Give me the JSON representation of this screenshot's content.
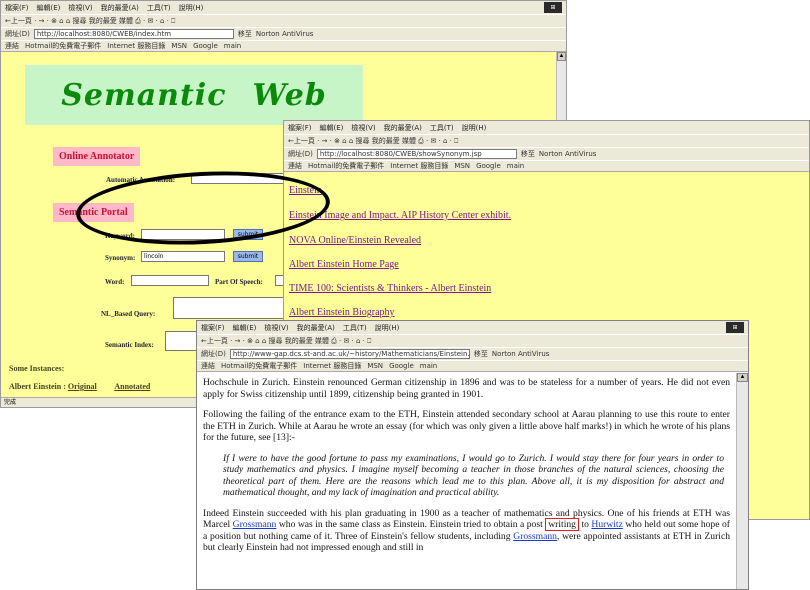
{
  "window1": {
    "menu": [
      "檔案(F)",
      "編輯(E)",
      "檢視(V)",
      "我的最愛(A)",
      "工具(T)",
      "說明(H)"
    ],
    "toolbar": "←上一頁 · → · ⊗ ⌂ ⌂ 搜尋 我的最愛 媒體 ⎙ · ✉ · ⌂ · ⎕",
    "address_label": "網址(D)",
    "address_value": "http://localhost:8080/CWEB/index.htm",
    "go_label": "移至",
    "norton_label": "Norton AntiVirus",
    "links_label": "連結",
    "links": [
      "Hotmail的免費電子郵件",
      "Internet 服務目錄",
      "MSN",
      "Google",
      "main"
    ],
    "title_word1": "Semantic",
    "title_word2": "Web",
    "online_annotator": "Online Annotator",
    "auto_annotation_label": "Automatic Annotation:",
    "semantic_portal": "Semantic Portal",
    "keyword_label": "Keyword:",
    "keyword_submit": "submit",
    "synonym_label": "Synonym:",
    "synonym_value": "lincoln",
    "synonym_submit": "submit",
    "word_label": "Word:",
    "pos_label": "Part Of Speech:",
    "nl_query_label": "NL_Based Query:",
    "semantic_index_label": "Semantic Index:",
    "some_instances": "Some Instances:",
    "instance_name": "Albert Einstein :",
    "instance_original": "Original",
    "instance_annotated": "Annotated",
    "status_text": "完成"
  },
  "window2": {
    "menu": [
      "檔案(F)",
      "編輯(E)",
      "檢視(V)",
      "我的最愛(A)",
      "工具(T)",
      "說明(H)"
    ],
    "toolbar": "←上一頁 · → · ⊗ ⌂ ⌂ 搜尋 我的最愛 媒體 ⎙ · ✉ · ⌂ · ⎕",
    "address_label": "網址(D)",
    "address_value": "http://localhost:8080/CWEB/showSynonym.jsp",
    "go_label": "移至",
    "norton_label": "Norton AntiVirus",
    "links_label": "連結",
    "links": [
      "Hotmail的免費電子郵件",
      "Internet 服務目錄",
      "MSN",
      "Google",
      "main"
    ],
    "results": [
      "Einstein",
      "Einstein Image and Impact. AIP History Center exhibit.",
      "NOVA Online/Einstein Revealed",
      "Albert Einstein Home Page",
      "TIME 100: Scientists & Thinkers - Albert Einstein",
      "Albert Einstein Biography"
    ]
  },
  "window3": {
    "menu": [
      "檔案(F)",
      "編輯(E)",
      "檢視(V)",
      "我的最愛(A)",
      "工具(T)",
      "說明(H)"
    ],
    "toolbar": "←上一頁 · → · ⊗ ⌂ ⌂ 搜尋 我的最愛 媒體 ⎙ · ✉ · ⌂ · ⎕",
    "address_label": "網址(D)",
    "address_value": "http://www-gap.dcs.st-and.ac.uk/~history/Mathematicians/Einstein.html",
    "go_label": "移至",
    "norton_label": "Norton AntiVirus",
    "links_label": "連結",
    "links": [
      "Hotmail的免費電子郵件",
      "Internet 服務目錄",
      "MSN",
      "Google",
      "main"
    ],
    "para1": "Hochschule in Zurich. Einstein renounced German citizenship in 1896 and was to be stateless for a number of years. He did not even apply for Swiss citizenship until 1899, citizenship being granted in 1901.",
    "para2": "Following the failing of the entrance exam to the ETH, Einstein attended secondary school at Aarau planning to use this route to enter the ETH in Zurich. While at Aarau he wrote an essay (for which was only given a little above half marks!) in which he wrote of his plans for the future, see [13]:-",
    "quote": "If I were to have the good fortune to pass my examinations, I would go to Zurich. I would stay there for four years in order to study mathematics and physics. I imagine myself becoming a teacher in those branches of the natural sciences, choosing the theoretical part of them. Here are the reasons which lead me to this plan. Above all, it is my disposition for abstract and mathematical thought, and my lack of imagination and practical ability.",
    "para3_a": "Indeed Einstein succeeded with his plan graduating in 1900 as a teacher of mathematics and physics. One of his friends at ETH was Marcel ",
    "para3_link1": "Grossmann",
    "para3_b": " who was in the same class as Einstein. Einstein tried to obtain a post",
    "para3_highlight": "writing",
    "para3_c": "to ",
    "para3_link2": "Hurwitz",
    "para3_d": " who held out some hope of a position but nothing came of it. Three of Einstein's fellow students, including ",
    "para3_link3": "Grossmann",
    "para3_e": ", were appointed assistants at ETH in Zurich but clearly Einstein had not impressed enough and still in"
  },
  "colors": {
    "page_yellow": "#ffff99",
    "title_green": "#0a8a0a",
    "title_bg": "#c8f5c8",
    "pink_label_bg": "#ffb8c8",
    "pink_label_text": "#c8103a",
    "visited_link": "#7a1a8a",
    "link_blue": "#1a3ad0",
    "highlight_red": "#e02020"
  }
}
